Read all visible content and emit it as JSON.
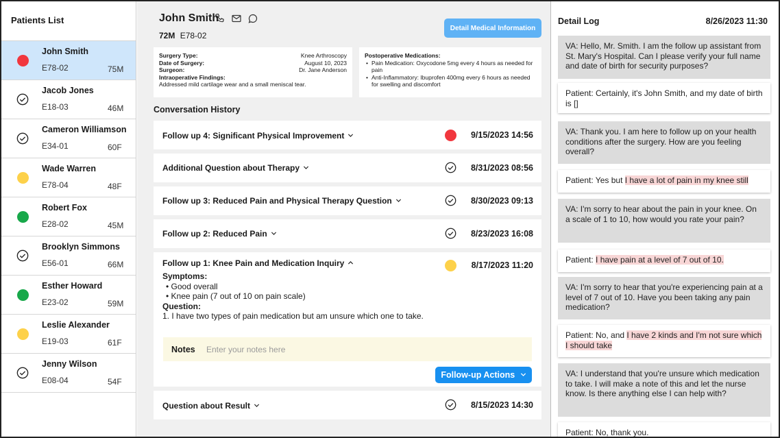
{
  "left": {
    "title": "Patients List",
    "patients": [
      {
        "name": "John Smith",
        "code": "E78-02",
        "age": "75M",
        "status": "red"
      },
      {
        "name": "Jacob Jones",
        "code": "E18-03",
        "age": "46M",
        "status": "check"
      },
      {
        "name": "Cameron Williamson",
        "code": "E34-01",
        "age": "60F",
        "status": "check"
      },
      {
        "name": "Wade Warren",
        "code": "E78-04",
        "age": "48F",
        "status": "yellow"
      },
      {
        "name": "Robert Fox",
        "code": "E28-02",
        "age": "45M",
        "status": "green"
      },
      {
        "name": "Brooklyn Simmons",
        "code": "E56-01",
        "age": "66M",
        "status": "check"
      },
      {
        "name": "Esther Howard",
        "code": "E23-02",
        "age": "59M",
        "status": "green"
      },
      {
        "name": "Leslie Alexander",
        "code": "E19-03",
        "age": "61F",
        "status": "yellow"
      },
      {
        "name": "Jenny Wilson",
        "code": "E08-04",
        "age": "54F",
        "status": "check"
      }
    ]
  },
  "header": {
    "name": "John Smith",
    "age_sex": "72M",
    "code": "E78-02",
    "detail_button": "Detail Medical Information",
    "icons": [
      "phone-icon",
      "mail-icon",
      "chat-icon"
    ]
  },
  "surgery": {
    "type_label": "Surgery Type:",
    "type_value": "Knee Arthroscopy",
    "date_label": "Date of Surgery:",
    "date_value": "August 10, 2023",
    "surgeon_label": "Surgeon:",
    "surgeon_value": "Dr. Jane Anderson",
    "findings_label": "Intraoperative Findings:",
    "findings_value": "Addressed mild cartilage wear and a small meniscal tear."
  },
  "medications": {
    "title": "Postoperative Medications:",
    "items": [
      "Pain Medication: Oxycodone 5mg every 4 hours as needed for pain",
      "Anti-Inflammatory: Ibuprofen 400mg every 6 hours as needed for swelling and discomfort"
    ]
  },
  "conversation": {
    "title": "Conversation History",
    "items": [
      {
        "title": "Follow up 4: Significant Physical Improvement",
        "date": "9/15/2023 14:56",
        "status": "red"
      },
      {
        "title": "Additional Question about Therapy",
        "date": "8/31/2023 08:56",
        "status": "check"
      },
      {
        "title": "Follow up 3: Reduced Pain and Physical Therapy Question",
        "date": "8/30/2023 09:13",
        "status": "check"
      },
      {
        "title": "Follow up 2: Reduced Pain",
        "date": "8/23/2023 16:08",
        "status": "check"
      },
      {
        "title": "Follow up 1: Knee Pain and Medication Inquiry",
        "date": "8/17/2023 11:20",
        "status": "yellow"
      },
      {
        "title": "Question about Result",
        "date": "8/15/2023 14:30",
        "status": "check"
      }
    ],
    "expanded": {
      "symptoms_label": "Symptoms:",
      "symptoms": [
        "Good overall",
        "Knee pain (7 out of 10 on pain scale)"
      ],
      "question_label": "Question:",
      "question": "1. I have two types of pain medication but am unsure which one to take.",
      "notes_label": "Notes",
      "notes_placeholder": "Enter your notes here",
      "notes_value": "",
      "follow_button": "Follow-up Actions"
    }
  },
  "log": {
    "title": "Detail Log",
    "date": "8/26/2023 11:30",
    "messages": [
      {
        "kind": "va",
        "prefix": "VA: Hello, Mr. Smith. I am the follow up assistant from St. Mary's Hospital. Can I please verify your full name and date of birth for security purposes?",
        "highlight": ""
      },
      {
        "kind": "pt",
        "prefix": "Patient: Certainly, it's John Smith, and my date of birth is []",
        "highlight": ""
      },
      {
        "kind": "va",
        "prefix": "VA: Thank you. I am here to follow up on your health conditions after the surgery. How are you feeling overall?",
        "highlight": ""
      },
      {
        "kind": "pt",
        "prefix": "Patient: Yes but ",
        "highlight": "I have a lot of pain in my knee still"
      },
      {
        "kind": "va",
        "prefix": "VA: I'm sorry to hear about the pain in your knee. On a scale of 1 to 10, how would you rate your pain?",
        "highlight": ""
      },
      {
        "kind": "pt",
        "prefix": "Patient: ",
        "highlight": "I have pain at a level of 7 out of 10."
      },
      {
        "kind": "va",
        "prefix": "VA: I'm sorry to hear that you're experiencing pain at a level of 7 out of 10. Have you been taking any pain medication?",
        "highlight": ""
      },
      {
        "kind": "pt",
        "prefix": "Patient: No, and ",
        "highlight": "I have 2 kinds and I'm not sure which I should take"
      },
      {
        "kind": "va",
        "prefix": "VA: I understand that you're unsure which medication to take. I will make a note of this and let the nurse know. Is there anything else I can help with?",
        "highlight": ""
      },
      {
        "kind": "pt",
        "prefix": "Patient: No, thank you.",
        "highlight": ""
      }
    ]
  },
  "colors": {
    "red": "#f1373e",
    "yellow": "#fdd14a",
    "green": "#18a84a",
    "selected_row": "#cfe6fb",
    "primary_button": "#1890f0",
    "highlight": "#f8d6d6"
  }
}
